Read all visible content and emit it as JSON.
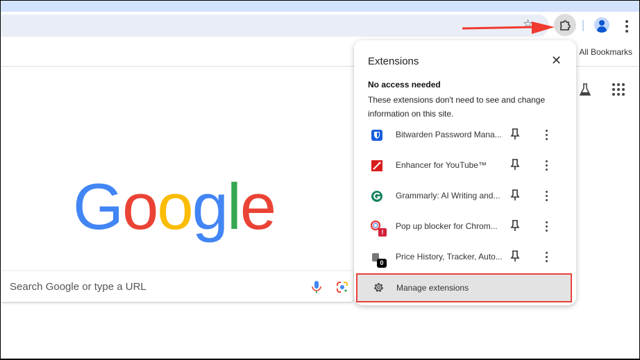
{
  "toolbar": {
    "bookmarks_label": "All Bookmarks"
  },
  "page": {
    "logo": "Google",
    "search_placeholder": "Search Google or type a URL"
  },
  "extensions_popup": {
    "title": "Extensions",
    "section_title": "No access needed",
    "section_description": "These extensions don't need to see and change information on this site.",
    "items": [
      {
        "name": "Bitwarden Password Mana...",
        "icon": "bitwarden-icon"
      },
      {
        "name": "Enhancer for YouTube™",
        "icon": "enhancer-icon"
      },
      {
        "name": "Grammarly: AI Writing and...",
        "icon": "grammarly-icon"
      },
      {
        "name": "Pop up blocker for Chrom...",
        "icon": "popup-blocker-icon",
        "badge": "!"
      },
      {
        "name": "Price History, Tracker, Auto...",
        "icon": "price-history-icon",
        "badge": "0"
      }
    ],
    "manage_label": "Manage extensions"
  },
  "colors": {
    "highlight": "#e8403a",
    "accent": "#0b57d0"
  }
}
